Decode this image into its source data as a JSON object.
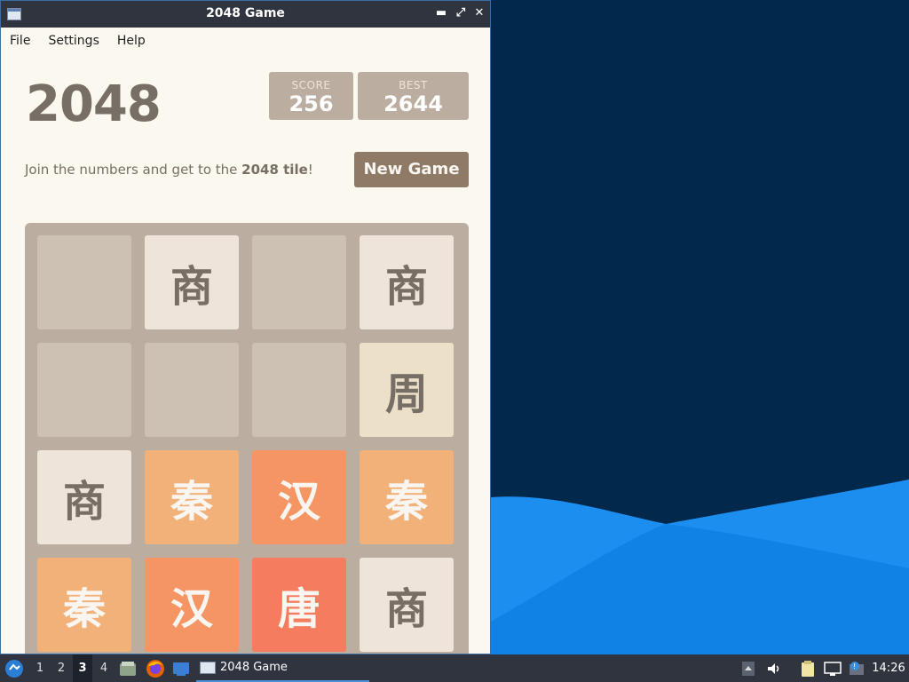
{
  "window": {
    "title": "2048 Game",
    "controls": {
      "minimize": "▬",
      "maximize": "⤢",
      "close": "✕"
    }
  },
  "menubar": {
    "file": "File",
    "settings": "Settings",
    "help": "Help"
  },
  "game": {
    "title": "2048",
    "score_label": "SCORE",
    "score": "256",
    "best_label": "BEST",
    "best": "2644",
    "intro_prefix": "Join the numbers and get to the ",
    "intro_bold": "2048 tile",
    "intro_suffix": "!",
    "new_game": "New Game"
  },
  "board": {
    "rows": [
      [
        "",
        "商",
        "",
        "商"
      ],
      [
        "",
        "",
        "",
        "周"
      ],
      [
        "商",
        "秦",
        "汉",
        "秦"
      ],
      [
        "秦",
        "汉",
        "唐",
        "商"
      ]
    ]
  },
  "tile_styles": {
    "": {
      "bg": "#cdc1b4",
      "fg": "#776e65"
    },
    "商": {
      "bg": "#eee4da",
      "fg": "#776e65"
    },
    "周": {
      "bg": "#ede0c8",
      "fg": "#776e65"
    },
    "秦": {
      "bg": "#f2b179",
      "fg": "#f9f6f2"
    },
    "汉": {
      "bg": "#f59563",
      "fg": "#f9f6f2"
    },
    "唐": {
      "bg": "#f67c5f",
      "fg": "#f9f6f2"
    }
  },
  "taskbar": {
    "workspaces": [
      "1",
      "2",
      "3",
      "4"
    ],
    "active_workspace": "3",
    "task_label": "2048 Game",
    "clock": "14:26"
  },
  "colors": {
    "desktop_bg": "#02284c",
    "wave_light": "#1c8ef0",
    "wave_dark": "#0a6fd0",
    "taskbar_bg": "#2f343f"
  }
}
